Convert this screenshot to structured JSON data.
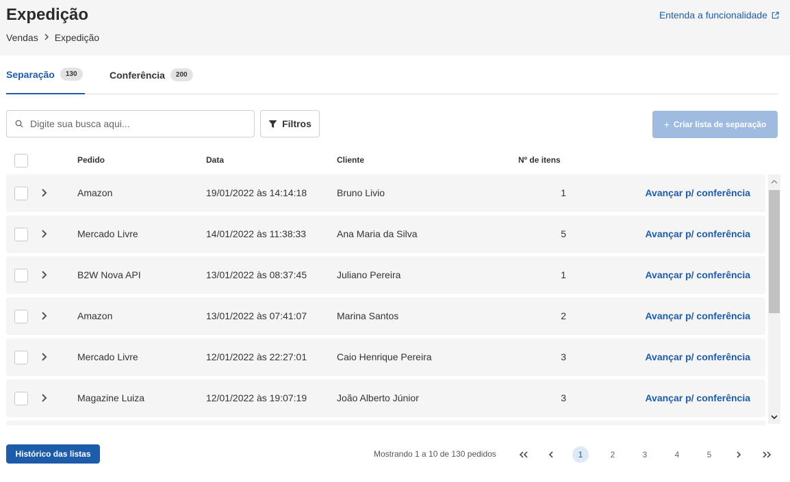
{
  "header": {
    "title": "Expedição",
    "help_link": "Entenda a funcionalidade",
    "breadcrumb": [
      "Vendas",
      "Expedição"
    ]
  },
  "tabs": [
    {
      "label": "Separação",
      "count": "130",
      "active": true
    },
    {
      "label": "Conferência",
      "count": "200",
      "active": false
    }
  ],
  "toolbar": {
    "search_placeholder": "Digite sua busca aqui...",
    "filter_label": "Filtros",
    "create_label": "Criar lista de separação"
  },
  "table": {
    "columns": [
      "Pedido",
      "Data",
      "Cliente",
      "Nº de itens"
    ],
    "action_label": "Avançar p/ conferência",
    "rows": [
      {
        "pedido": "Amazon",
        "data": "19/01/2022 às 14:14:18",
        "cliente": "Bruno Livio",
        "itens": "1"
      },
      {
        "pedido": "Mercado Livre",
        "data": "14/01/2022 às 11:38:33",
        "cliente": "Ana Maria da Silva",
        "itens": "5"
      },
      {
        "pedido": "B2W Nova API",
        "data": "13/01/2022 às 08:37:45",
        "cliente": "Juliano Pereira",
        "itens": "1"
      },
      {
        "pedido": "Amazon",
        "data": "13/01/2022 às 07:41:07",
        "cliente": "Marina Santos",
        "itens": "2"
      },
      {
        "pedido": "Mercado Livre",
        "data": "12/01/2022 às 22:27:01",
        "cliente": "Caio Henrique Pereira",
        "itens": "3"
      },
      {
        "pedido": "Magazine Luiza",
        "data": "12/01/2022 às 19:07:19",
        "cliente": "João Alberto Júnior",
        "itens": "3"
      }
    ]
  },
  "footer": {
    "history_label": "Histórico das listas",
    "pager_info": "Mostrando 1 a 10 de 130 pedidos",
    "pages": [
      "1",
      "2",
      "3",
      "4",
      "5"
    ],
    "current_page": "1"
  },
  "colors": {
    "accent": "#1d5cab",
    "header_bg": "#f4f5f4",
    "row_bg": "#f4f5f4",
    "disabled_button": "#9fbbe0"
  }
}
